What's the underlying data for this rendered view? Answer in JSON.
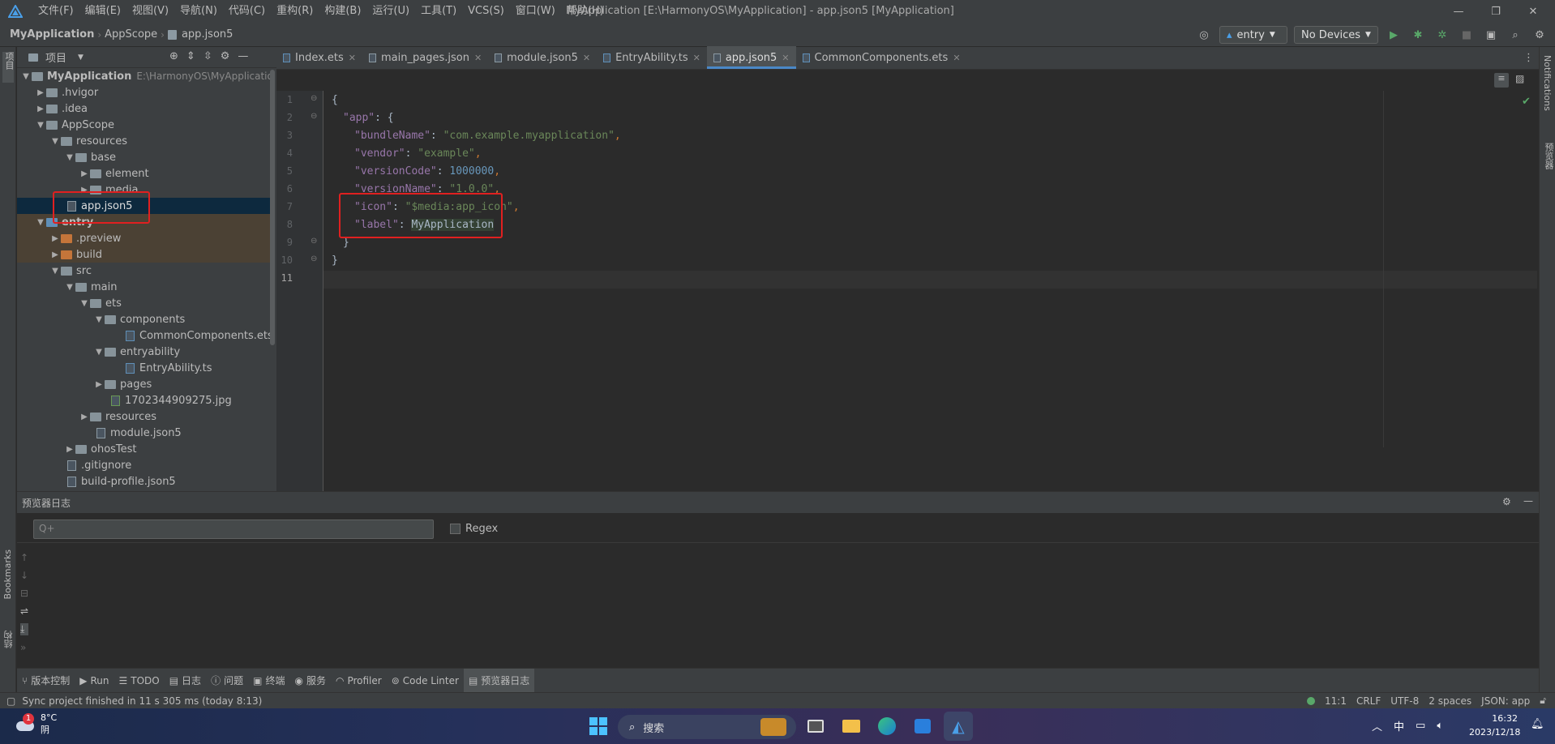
{
  "titlebar": {
    "menus": [
      "文件(F)",
      "编辑(E)",
      "视图(V)",
      "导航(N)",
      "代码(C)",
      "重构(R)",
      "构建(B)",
      "运行(U)",
      "工具(T)",
      "VCS(S)",
      "窗口(W)",
      "帮助(H)"
    ],
    "window_title": "MyApplication [E:\\HarmonyOS\\MyApplication] - app.json5 [MyApplication]"
  },
  "navbar": {
    "breadcrumbs": [
      "MyApplication",
      "AppScope",
      "app.json5"
    ],
    "run_config": "entry",
    "device": "No Devices"
  },
  "sidebar": {
    "project_label": "项目",
    "left_strip_label": "项目",
    "bookmarks": "Bookmarks",
    "structure": "结构"
  },
  "rightstrip": {
    "notifications": "Notifications",
    "preview": "预览器"
  },
  "project_panel": {
    "title": "项目",
    "tree": [
      {
        "label": "MyApplication",
        "hint": "E:\\HarmonyOS\\MyApplicatio",
        "level": 0,
        "type": "root",
        "open": true
      },
      {
        "label": ".hvigor",
        "level": 1,
        "type": "folder",
        "open": false
      },
      {
        "label": ".idea",
        "level": 1,
        "type": "folder",
        "open": false
      },
      {
        "label": "AppScope",
        "level": 1,
        "type": "folder",
        "open": true
      },
      {
        "label": "resources",
        "level": 2,
        "type": "folder",
        "open": true
      },
      {
        "label": "base",
        "level": 3,
        "type": "folder",
        "open": true
      },
      {
        "label": "element",
        "level": 4,
        "type": "folder",
        "open": false
      },
      {
        "label": "media",
        "level": 4,
        "type": "folder",
        "open": false
      },
      {
        "label": "app.json5",
        "level": 3,
        "type": "file",
        "selected": true
      },
      {
        "label": "entry",
        "level": 1,
        "type": "folder-blue",
        "open": true
      },
      {
        "label": ".preview",
        "level": 2,
        "type": "folder-orange",
        "open": false
      },
      {
        "label": "build",
        "level": 2,
        "type": "folder-orange",
        "open": false
      },
      {
        "label": "src",
        "level": 2,
        "type": "folder",
        "open": true
      },
      {
        "label": "main",
        "level": 3,
        "type": "folder",
        "open": true
      },
      {
        "label": "ets",
        "level": 4,
        "type": "folder",
        "open": true
      },
      {
        "label": "components",
        "level": 5,
        "type": "folder",
        "open": true
      },
      {
        "label": "CommonComponents.ets",
        "level": 6,
        "type": "file-ts"
      },
      {
        "label": "entryability",
        "level": 5,
        "type": "folder",
        "open": true
      },
      {
        "label": "EntryAbility.ts",
        "level": 6,
        "type": "file-ts"
      },
      {
        "label": "pages",
        "level": 5,
        "type": "folder",
        "open": false
      },
      {
        "label": "1702344909275.jpg",
        "level": 5,
        "type": "file"
      },
      {
        "label": "resources",
        "level": 4,
        "type": "folder",
        "open": false
      },
      {
        "label": "module.json5",
        "level": 4,
        "type": "file"
      },
      {
        "label": "ohosTest",
        "level": 3,
        "type": "folder",
        "open": false
      },
      {
        "label": ".gitignore",
        "level": 2,
        "type": "file"
      },
      {
        "label": "build-profile.json5",
        "level": 2,
        "type": "file"
      }
    ]
  },
  "editor": {
    "tabs": [
      {
        "label": "Index.ets",
        "active": false
      },
      {
        "label": "main_pages.json",
        "active": false
      },
      {
        "label": "module.json5",
        "active": false
      },
      {
        "label": "EntryAbility.ts",
        "active": false
      },
      {
        "label": "app.json5",
        "active": true
      },
      {
        "label": "CommonComponents.ets",
        "active": false
      }
    ],
    "line_numbers": [
      "1",
      "2",
      "3",
      "4",
      "5",
      "6",
      "7",
      "8",
      "9",
      "10",
      "11"
    ],
    "code": {
      "l1": "{",
      "l2_key": "\"app\"",
      "l2_rest": ": {",
      "l3_key": "\"bundleName\"",
      "l3_val": "\"com.example.myapplication\"",
      "l4_key": "\"vendor\"",
      "l4_val": "\"example\"",
      "l5_key": "\"versionCode\"",
      "l5_val": "1000000",
      "l6_key": "\"versionName\"",
      "l6_val": "\"1.0.0\"",
      "l7_key": "\"icon\"",
      "l7_val": "\"$media:app_icon\"",
      "l8_key": "\"label\"",
      "l8_val": "MyApplication",
      "l9": "}",
      "l10": "}"
    }
  },
  "log_panel": {
    "title": "预览器日志",
    "search_placeholder": "Q+",
    "regex_label": "Regex"
  },
  "bottom_tabs": [
    "版本控制",
    "Run",
    "TODO",
    "日志",
    "问题",
    "终端",
    "服务",
    "Profiler",
    "Code Linter",
    "预览器日志"
  ],
  "statusbar": {
    "message": "Sync project finished in 11 s 305 ms (today 8:13)",
    "position": "11:1",
    "line_sep": "CRLF",
    "encoding": "UTF-8",
    "indent": "2 spaces",
    "schema": "JSON: app"
  },
  "taskbar": {
    "weather_temp": "8°C",
    "weather_desc": "阴",
    "badge": "1",
    "search": "搜索",
    "ime": "中",
    "time": "16:32",
    "date": "2023/12/18"
  },
  "colors": {
    "accent": "#4a88c7",
    "highlight_box": "#e02020",
    "bg": "#2b2b2b",
    "panel": "#3c3f41"
  }
}
